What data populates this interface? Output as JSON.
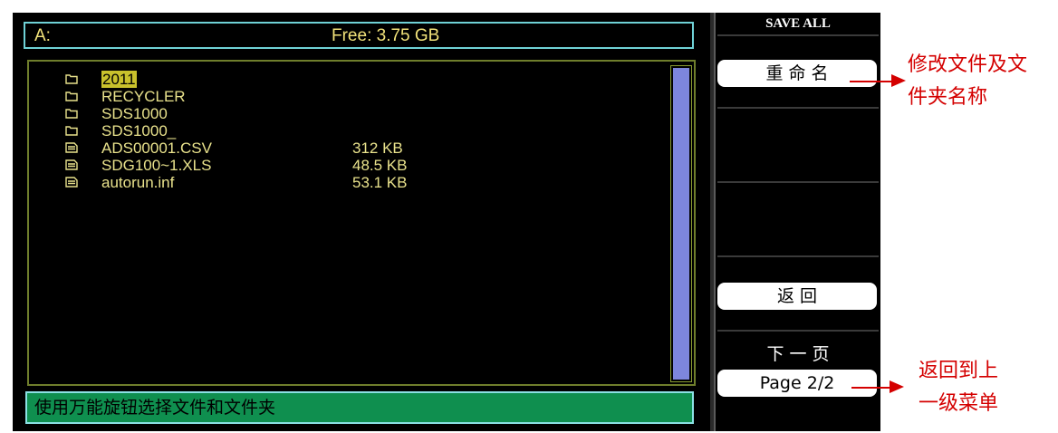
{
  "path_bar": {
    "drive": "A:",
    "free": "Free: 3.75 GB"
  },
  "files": [
    {
      "type": "folder",
      "name": "2011",
      "size": "",
      "selected": true
    },
    {
      "type": "folder",
      "name": "RECYCLER",
      "size": ""
    },
    {
      "type": "folder",
      "name": "SDS1000",
      "size": ""
    },
    {
      "type": "folder",
      "name": "SDS1000_",
      "size": ""
    },
    {
      "type": "file",
      "name": "ADS00001.CSV",
      "size": "312 KB"
    },
    {
      "type": "file",
      "name": "SDG100~1.XLS",
      "size": "48.5 KB"
    },
    {
      "type": "file",
      "name": "autorun.inf",
      "size": "53.1 KB"
    }
  ],
  "status_text": "使用万能旋钮选择文件和文件夹",
  "menu": {
    "title": "SAVE ALL",
    "rename": "重 命 名",
    "back": "返 回",
    "next_page_label": "下 一 页",
    "page": "Page 2/2"
  },
  "annotations": {
    "rename_note_line1": "修改文件及文",
    "rename_note_line2": "件夹名称",
    "back_note_line1": "返回到上",
    "back_note_line2": "一级菜单"
  },
  "colors": {
    "text_yellow": "#e9e28c",
    "status_green": "#0f8f4f",
    "scroll_blue": "#7d86dd",
    "annotation_red": "#d40000"
  }
}
